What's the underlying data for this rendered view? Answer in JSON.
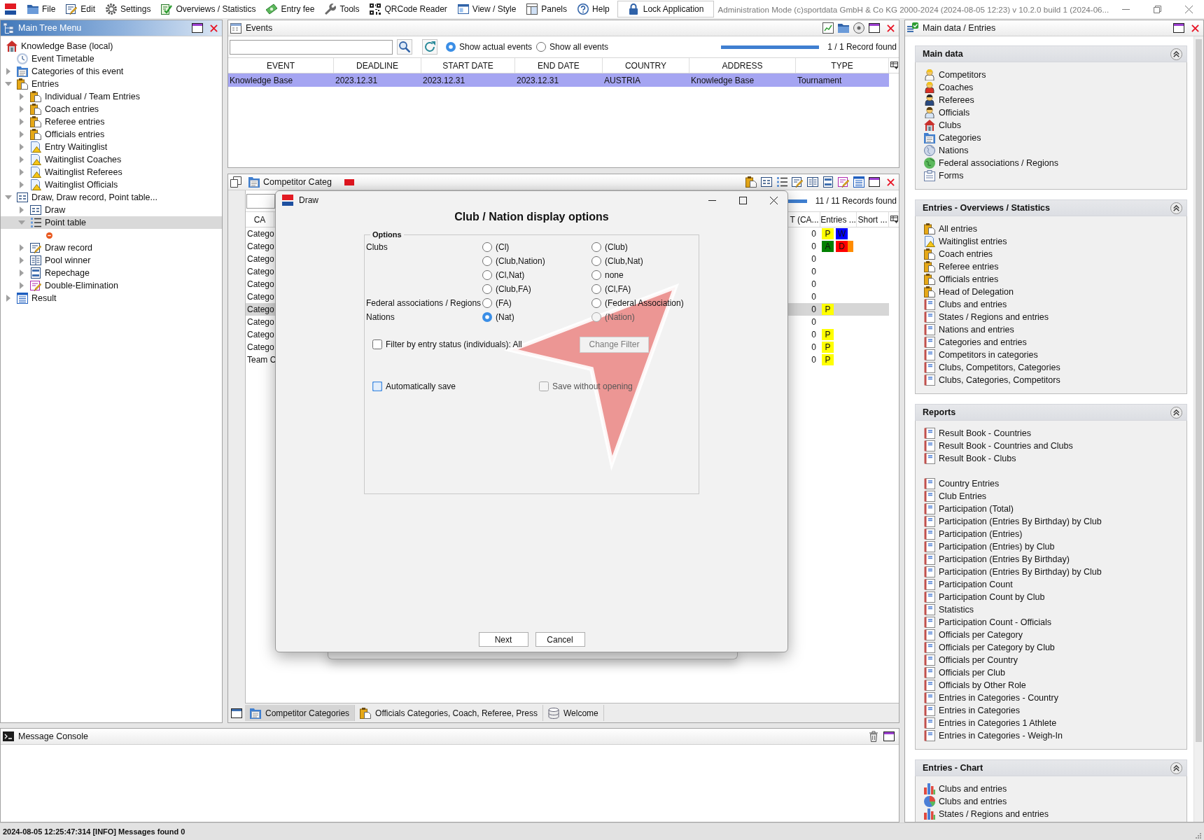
{
  "menu_bar": {
    "items": [
      {
        "label": "File",
        "kind": "folder"
      },
      {
        "label": "Edit",
        "kind": "edit"
      },
      {
        "label": "Settings",
        "kind": "gear"
      },
      {
        "label": "Overviews / Statistics",
        "kind": "overview"
      },
      {
        "label": "Entry fee",
        "kind": "money"
      },
      {
        "label": "Tools",
        "kind": "wrench"
      },
      {
        "label": "QRCode Reader",
        "kind": "qrcode"
      },
      {
        "label": "View / Style",
        "kind": "window"
      },
      {
        "label": "Panels",
        "kind": "panels"
      },
      {
        "label": "Help",
        "kind": "help"
      }
    ],
    "lock_button": "Lock Application",
    "info": "Administration Mode (c)sportdata GmbH & Co KG 2000-2024 (2024-08-05 12:23) v 10.2.0 build 1 (2024-06..."
  },
  "tree_panel": {
    "title": "Main Tree Menu",
    "active": true,
    "nodes": [
      {
        "label": "Knowledge Base (local)",
        "kind": "home",
        "selected": false,
        "children": [
          {
            "label": "Event Timetable",
            "kind": "clock",
            "selected": false
          },
          {
            "label": "Categories of this event",
            "kind": "categories",
            "selected": false,
            "expanded": false
          },
          {
            "label": "Entries",
            "kind": "entries",
            "selected": false,
            "expanded": true,
            "children": [
              {
                "label": "Individual / Team Entries",
                "kind": "entries",
                "selected": false,
                "expanded": false
              },
              {
                "label": "Coach entries",
                "kind": "entries",
                "selected": false,
                "expanded": false
              },
              {
                "label": "Referee entries",
                "kind": "entries",
                "selected": false,
                "expanded": false
              },
              {
                "label": "Officials entries",
                "kind": "entries",
                "selected": false,
                "expanded": false
              },
              {
                "label": "Entry Waitinglist",
                "kind": "waitinglist",
                "selected": false,
                "expanded": false
              },
              {
                "label": "Waitinglist Coaches",
                "kind": "waitinglist",
                "selected": false,
                "expanded": false
              },
              {
                "label": "Waitinglist Referees",
                "kind": "waitinglist",
                "selected": false,
                "expanded": false
              },
              {
                "label": "Waitinglist Officials",
                "kind": "waitinglist",
                "selected": false,
                "expanded": false
              }
            ]
          },
          {
            "label": "Draw, Draw record, Point table...",
            "kind": "draw",
            "selected": false,
            "expanded": true,
            "children": [
              {
                "label": "Draw",
                "kind": "draw",
                "selected": false,
                "expanded": false
              },
              {
                "label": "Point table",
                "kind": "points",
                "selected": true,
                "expanded": true,
                "children": [
                  {
                    "kind": "minus",
                    "selected": false
                  }
                ]
              },
              {
                "label": "Draw record",
                "kind": "record",
                "selected": false,
                "expanded": false
              },
              {
                "label": "Pool winner",
                "kind": "pool",
                "selected": false,
                "expanded": false
              },
              {
                "label": "Repechage",
                "kind": "repechage",
                "selected": false,
                "expanded": false
              },
              {
                "label": "Double-Elimination",
                "kind": "double",
                "selected": false,
                "expanded": false
              }
            ]
          },
          {
            "label": "Result",
            "kind": "result",
            "selected": false,
            "expanded": false
          }
        ]
      }
    ]
  },
  "events_panel": {
    "title": "Events",
    "active": false,
    "filters": [
      {
        "label": "Show actual events",
        "selected": true
      },
      {
        "label": "Show all events",
        "selected": false
      }
    ],
    "progress": {
      "level": 1
    },
    "record_count": "1 / 1 Record found",
    "table": {
      "columns": [
        "EVENT",
        "DEADLINE",
        "START DATE",
        "END DATE",
        "COUNTRY",
        "ADDRESS",
        "TYPE"
      ],
      "rows": [
        {
          "cells": [
            "Knowledge Base",
            "2023.12.31",
            "2023.12.31",
            "2023.12.31",
            "AUSTRIA",
            "Knowledge Base",
            "Tournament"
          ],
          "selected": true
        }
      ]
    }
  },
  "categories_panel": {
    "title": "Competitor Categ",
    "active": false,
    "progress": {
      "level": 1
    },
    "record_count": "11 / 11 Records found",
    "columns": [
      "CA",
      "T (CA...",
      "Entries ...",
      "Short ..."
    ],
    "rows": [
      {
        "cells": [
          "Catego",
          "0"
        ],
        "badges": [
          {
            "label": "P",
            "color": "#ffff00"
          },
          {
            "label": "W",
            "color": "#0000ff"
          }
        ],
        "selected": false
      },
      {
        "cells": [
          "Catego",
          "0"
        ],
        "badges": [
          {
            "label": "A",
            "color": "#008000"
          },
          {
            "label": "D",
            "color": "#ff0000"
          },
          {
            "color": "#ff8c00"
          }
        ],
        "selected": false
      },
      {
        "cells": [
          "Catego",
          "0"
        ],
        "selected": false
      },
      {
        "cells": [
          "Catego",
          "0"
        ],
        "selected": false
      },
      {
        "cells": [
          "Catego",
          "0"
        ],
        "selected": false
      },
      {
        "cells": [
          "Catego",
          "0"
        ],
        "selected": false
      },
      {
        "cells": [
          "Catego",
          "0"
        ],
        "badges": [
          {
            "label": "P",
            "color": "#ffff00"
          }
        ],
        "selected": true
      },
      {
        "cells": [
          "Catego",
          "0"
        ],
        "selected": false
      },
      {
        "cells": [
          "Catego",
          "0"
        ],
        "badges": [
          {
            "label": "P",
            "color": "#ffff00"
          }
        ],
        "selected": false
      },
      {
        "cells": [
          "Catego",
          "0"
        ],
        "badges": [
          {
            "label": "P",
            "color": "#ffff00"
          }
        ],
        "selected": false
      },
      {
        "cells": [
          "Team C",
          "0"
        ],
        "badges": [
          {
            "label": "P",
            "color": "#ffff00"
          }
        ],
        "selected": false
      }
    ],
    "tabs": [
      {
        "label": "Competitor Categories",
        "selected": true
      },
      {
        "label": "Officials Categories, Coach, Referee, Press",
        "selected": false
      },
      {
        "label": "Welcome",
        "selected": false
      }
    ]
  },
  "console_panel": {
    "title": "Message Console",
    "active": false
  },
  "main_data_panel": {
    "title": "Main data / Entries",
    "active": false,
    "sections": [
      {
        "title": "Main data",
        "expanded": true,
        "groups": [
          {
            "items": [
              {
                "label": "Competitors",
                "kind": "competitor"
              },
              {
                "label": "Coaches",
                "kind": "coach"
              },
              {
                "label": "Referees",
                "kind": "referee"
              },
              {
                "label": "Officials",
                "kind": "official"
              },
              {
                "label": "Clubs",
                "kind": "club"
              },
              {
                "label": "Categories",
                "kind": "category"
              },
              {
                "label": "Nations",
                "kind": "nation"
              },
              {
                "label": "Federal associations / Regions",
                "kind": "federation"
              },
              {
                "label": "Forms",
                "kind": "form"
              }
            ]
          }
        ]
      },
      {
        "title": "Entries - Overviews / Statistics",
        "expanded": true,
        "groups": [
          {
            "items": [
              {
                "label": "All entries",
                "kind": "entries"
              },
              {
                "label": "Waitinglist entries",
                "kind": "waitinglist"
              },
              {
                "label": "Coach entries",
                "kind": "entries"
              },
              {
                "label": "Referee entries",
                "kind": "entries"
              },
              {
                "label": "Officials entries",
                "kind": "entries"
              },
              {
                "label": "Head of Delegation",
                "kind": "entries"
              },
              {
                "label": "Clubs and entries",
                "kind": "report"
              },
              {
                "label": "States / Regions and entries",
                "kind": "report"
              },
              {
                "label": "Nations and entries",
                "kind": "report"
              },
              {
                "label": "Categories and entries",
                "kind": "report"
              },
              {
                "label": "Competitors in categories",
                "kind": "report"
              },
              {
                "label": "Clubs, Competitors, Categories",
                "kind": "report"
              },
              {
                "label": "Clubs, Categories, Competitors",
                "kind": "report"
              }
            ]
          }
        ]
      },
      {
        "title": "Reports",
        "expanded": true,
        "groups": [
          {
            "items": [
              {
                "label": "Result Book - Countries",
                "kind": "report"
              },
              {
                "label": "Result Book - Countries and Clubs",
                "kind": "report"
              },
              {
                "label": "Result Book - Clubs",
                "kind": "report"
              }
            ]
          },
          {
            "items": [
              {
                "label": "Country Entries",
                "kind": "report"
              },
              {
                "label": "Club Entries",
                "kind": "report"
              },
              {
                "label": "Participation (Total)",
                "kind": "report"
              },
              {
                "label": "Participation (Entries By Birthday) by Club",
                "kind": "report"
              },
              {
                "label": "Participation (Entries)",
                "kind": "report"
              },
              {
                "label": "Participation (Entries) by Club",
                "kind": "report"
              },
              {
                "label": "Participation (Entries By Birthday)",
                "kind": "report"
              },
              {
                "label": "Participation (Entries By Birthday) by Club",
                "kind": "report"
              },
              {
                "label": "Participation Count",
                "kind": "report"
              },
              {
                "label": "Participation Count by Club",
                "kind": "report"
              },
              {
                "label": "Statistics",
                "kind": "report"
              },
              {
                "label": "Participation Count - Officials",
                "kind": "report"
              },
              {
                "label": "Officials per Category",
                "kind": "report"
              },
              {
                "label": "Officials per Category by Club",
                "kind": "report"
              },
              {
                "label": "Officials per Country",
                "kind": "report"
              },
              {
                "label": "Officials per Club",
                "kind": "report"
              },
              {
                "label": "Officials by Other Role",
                "kind": "report"
              },
              {
                "label": "Entries in Categories - Country",
                "kind": "report"
              },
              {
                "label": "Entries in Categories",
                "kind": "report"
              },
              {
                "label": "Entries in Categories 1 Athlete",
                "kind": "report"
              },
              {
                "label": "Entries in Categories - Weigh-In",
                "kind": "report"
              }
            ]
          }
        ]
      },
      {
        "title": "Entries - Chart",
        "expanded": true,
        "groups": [
          {
            "items": [
              {
                "label": "Clubs and entries",
                "kind": "barchart"
              },
              {
                "label": "Clubs and entries",
                "kind": "piechart"
              },
              {
                "label": "States / Regions and entries",
                "kind": "barchart"
              }
            ]
          }
        ]
      }
    ]
  },
  "status_bar": "2024-08-05 12:25:47:314 [INFO] Messages found 0",
  "dialog": {
    "title": "Draw",
    "heading": "Club / Nation display options",
    "options": {
      "title": "Options",
      "groups": [
        {
          "label": "Clubs",
          "choices": [
            {
              "label": "(Cl)",
              "selected": false,
              "disabled": false
            },
            {
              "label": "(Club)",
              "selected": false,
              "disabled": false
            },
            {
              "label": "(Club,Nation)",
              "selected": false,
              "disabled": false
            },
            {
              "label": "(Club,Nat)",
              "selected": false,
              "disabled": false
            },
            {
              "label": "(Cl,Nat)",
              "selected": false,
              "disabled": false
            },
            {
              "label": "none",
              "selected": false,
              "disabled": false
            },
            {
              "label": "(Club,FA)",
              "selected": false,
              "disabled": false
            },
            {
              "label": "(Cl,FA)",
              "selected": false,
              "disabled": false
            }
          ]
        },
        {
          "label": "Federal associations / Regions",
          "choices": [
            {
              "label": "(FA)",
              "selected": false,
              "disabled": false
            },
            {
              "label": "(Federal Association)",
              "selected": false,
              "disabled": false
            }
          ]
        },
        {
          "label": "Nations",
          "choices": [
            {
              "label": "(Nat)",
              "selected": true,
              "disabled": false
            },
            {
              "label": "(Nation)",
              "selected": false,
              "disabled": true
            }
          ]
        }
      ]
    },
    "filter": {
      "label": "Filter by entry status (individuals): All",
      "checked": false
    },
    "change_filter_button": {
      "label": "Change Filter",
      "disabled": true
    },
    "save_options": [
      {
        "label": "Automatically save",
        "checked": false,
        "disabled": false,
        "focused": true
      },
      {
        "label": "Save without opening",
        "checked": false,
        "disabled": true,
        "focused": false
      }
    ],
    "buttons": [
      "Next",
      "Cancel"
    ]
  },
  "annotation": {
    "kind": "arrow"
  }
}
